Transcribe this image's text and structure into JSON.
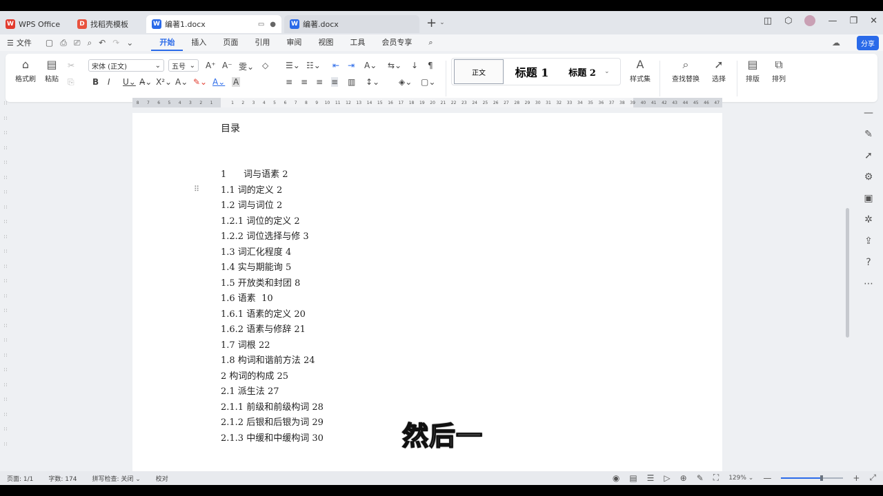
{
  "tabs": [
    {
      "label": "WPS Office",
      "logo": "W",
      "color": "#e23b2e"
    },
    {
      "label": "找稻壳模板",
      "logo": "D",
      "color": "#e8513d"
    },
    {
      "label": "编著1.docx",
      "logo": "W",
      "color": "#2a6ae9"
    },
    {
      "label": "编著.docx",
      "logo": "W",
      "color": "#2a6ae9"
    }
  ],
  "menubar": {
    "file_label": "文件",
    "tabs": [
      "开始",
      "插入",
      "页面",
      "引用",
      "审阅",
      "视图",
      "工具",
      "会员专享"
    ],
    "share_label": "分享"
  },
  "ribbon": {
    "format_painter": "格式刷",
    "paste": "粘贴",
    "font_name": "宋体 (正文)",
    "font_size": "五号",
    "styles": [
      "正文",
      "标题 1",
      "标题 2"
    ],
    "style_set": "样式集",
    "find_replace": "查找替换",
    "select": "选择",
    "layout": "排版",
    "arrange": "排列"
  },
  "ruler_ticks": [
    "8",
    "7",
    "6",
    "5",
    "4",
    "3",
    "2",
    "1",
    "",
    "1",
    "2",
    "3",
    "4",
    "5",
    "6",
    "7",
    "8",
    "9",
    "10",
    "11",
    "12",
    "13",
    "14",
    "15",
    "16",
    "17",
    "18",
    "19",
    "20",
    "21",
    "22",
    "23",
    "24",
    "25",
    "26",
    "27",
    "28",
    "29",
    "30",
    "31",
    "32",
    "33",
    "34",
    "35",
    "36",
    "37",
    "38",
    "39",
    "40",
    "41",
    "42",
    "43",
    "44",
    "45",
    "46",
    "47"
  ],
  "document": {
    "toc_title": "目录",
    "toc_entries": [
      "1      词与语素 2",
      "1.1 词的定义 2",
      "1.2 词与词位 2",
      "1.2.1 词位的定义 2",
      "1.2.2 词位选择与修 3",
      "1.3 词汇化程度 4",
      "1.4 实与期能询 5",
      "1.5 开放类和封团 8",
      "1.6 语素  10",
      "1.6.1 语素的定义 20",
      "1.6.2 语素与修辞 21",
      "1.7 词根 22",
      "1.8 构词和谐前方法 24",
      "2 构词的构成 25",
      "2.1 派生法 27",
      "2.1.1 前级和前级构词 28",
      "2.1.2 后银和后银为词 29",
      "2.1.3 中缓和中缓构词 30"
    ]
  },
  "caption": "然后一",
  "statusbar": {
    "page": "页面: 1/1",
    "words": "字数: 174",
    "spellcheck": "拼写检查: 关闭",
    "proof": "校对",
    "zoom": "129%",
    "zoom_fraction": 0.65
  }
}
